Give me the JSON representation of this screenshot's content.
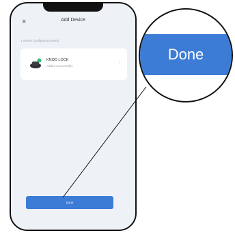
{
  "header": {
    "close_glyph": "×",
    "title": "Add Device"
  },
  "subtitle": "1 device (configure process)",
  "device": {
    "name": "KNOD LOCK",
    "status": "Added successfully",
    "icon": "lock-device-icon"
  },
  "footer": {
    "done_label": "Done"
  },
  "magnifier": {
    "label": "Done"
  },
  "colors": {
    "accent": "#3c7bd6",
    "screen_bg": "#eef2f7"
  }
}
